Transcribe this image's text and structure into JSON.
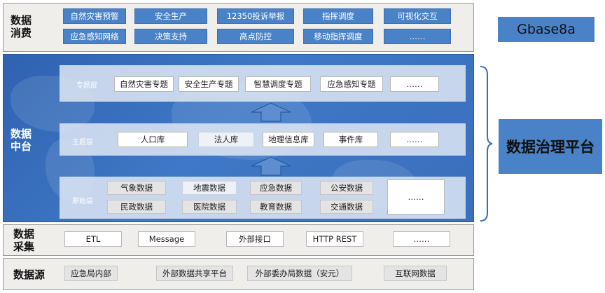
{
  "consume": {
    "label": "数据\n消费",
    "row1": [
      "自然灾害预警",
      "安全生产",
      "12350投诉举报",
      "指挥调度",
      "可视化交互"
    ],
    "row2": [
      "应急感知网络",
      "决策支持",
      "高点防控",
      "移动指挥调度",
      "……"
    ]
  },
  "hub": {
    "label": "数据\n中台",
    "topic_layer": {
      "label": "专题层",
      "items": [
        "自然灾害专题",
        "安全生产专题",
        "智慧调度专题",
        "应急感知专题",
        "……"
      ]
    },
    "subject_layer": {
      "label": "主题层",
      "items": [
        "人口库",
        "法人库",
        "地理信息库",
        "事件库",
        "……"
      ]
    },
    "raw_layer": {
      "label": "原始层",
      "row1": [
        "气象数据",
        "地震数据",
        "应急数据",
        "公安数据"
      ],
      "row2": [
        "民政数据",
        "医院数据",
        "教育数据",
        "交通数据"
      ],
      "more": "……"
    }
  },
  "collect": {
    "label": "数据\n采集",
    "items": [
      "ETL",
      "Message",
      "外部接口",
      "HTTP REST",
      "……"
    ]
  },
  "source": {
    "label": "数据源",
    "items": [
      "应急局内部",
      "外部数据共享平台",
      "外部委办局数据（安元）",
      "互联网数据"
    ]
  },
  "side": {
    "gbase": "Gbase8a",
    "platform": "数据治理平台"
  },
  "colors": {
    "hub_blue": "#3f78c6",
    "chip_blue": "#4a82c8",
    "band_grey": "#f0eeeb"
  }
}
